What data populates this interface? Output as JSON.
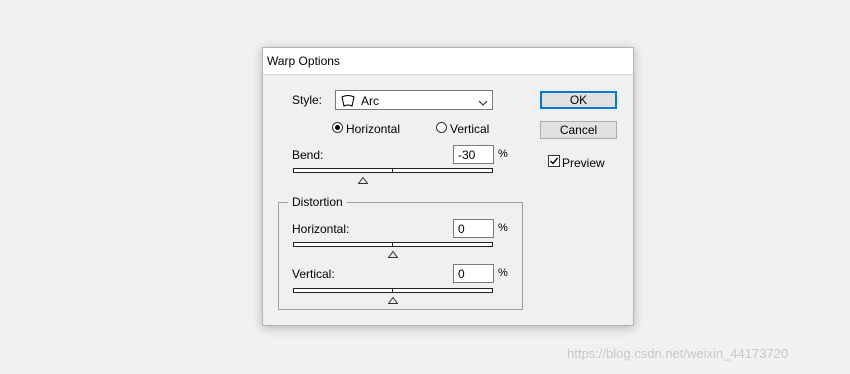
{
  "dialog": {
    "title": "Warp Options",
    "style_label": "Style:",
    "style_value": "Arc",
    "style_icon": "arc-warp-icon",
    "orientation": {
      "horizontal_label": "Horizontal",
      "vertical_label": "Vertical",
      "selected": "Horizontal"
    },
    "bend": {
      "label": "Bend:",
      "value": "-30",
      "unit": "%"
    },
    "distortion": {
      "title": "Distortion",
      "horizontal": {
        "label": "Horizontal:",
        "value": "0",
        "unit": "%"
      },
      "vertical": {
        "label": "Vertical:",
        "value": "0",
        "unit": "%"
      }
    },
    "buttons": {
      "ok": "OK",
      "cancel": "Cancel"
    },
    "preview": {
      "label": "Preview",
      "checked": true
    }
  },
  "watermark": "https://blog.csdn.net/weixin_44173720"
}
